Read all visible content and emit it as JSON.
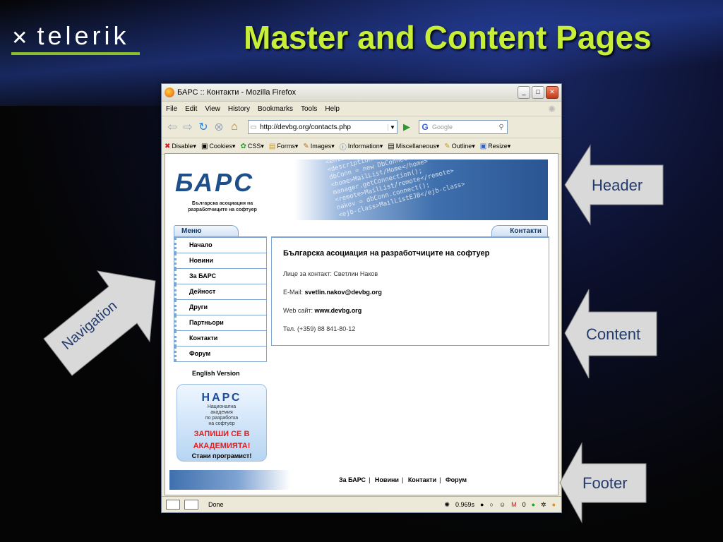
{
  "slide": {
    "logo_text": "telerik",
    "title": "Master and Content Pages"
  },
  "browser": {
    "window_title": "БАРС :: Контакти - Mozilla Firefox",
    "menu": [
      "File",
      "Edit",
      "View",
      "History",
      "Bookmarks",
      "Tools",
      "Help"
    ],
    "url": "http://devbg.org/contacts.php",
    "search_placeholder": "Google",
    "devbar": [
      "Disable▾",
      "Cookies▾",
      "CSS▾",
      "Forms▾",
      "Images▾",
      "Information▾",
      "Miscellaneous▾",
      "Outline▾",
      "Resize▾"
    ],
    "status_text": "Done",
    "status_time": "0.969s",
    "mail_count": "0"
  },
  "site": {
    "logo": "БАРС",
    "logo_sub": "Българска асоциация на разработчиците на софтуер",
    "menu_title": "Меню",
    "menu_items": [
      "Начало",
      "Новини",
      "За БАРС",
      "Дейност",
      "Други",
      "Партньори",
      "Контакти",
      "Форум"
    ],
    "english_link": "English Version",
    "ad": {
      "brand": "НАРС",
      "sub1": "Национална",
      "sub2": "академия",
      "sub3": "по разработка",
      "sub4": "на софтуер",
      "cta1": "ЗАПИШИ СЕ В",
      "cta2": "АКАДЕМИЯТА!",
      "cta3": "Стани програмист!"
    },
    "content_tab": "Контакти",
    "content": {
      "heading": "Българска асоциация на разработчиците на софтуер",
      "contact_label": "Лице за контакт: Светлин Наков",
      "email_label": "E-Mail:",
      "email_value": "svetlin.nakov@devbg.org",
      "web_label": "Web сайт:",
      "web_value": "www.devbg.org",
      "phone": "Тел. (+359) 88 841-80-12"
    },
    "footer_links": [
      "За БАРС",
      "Новини",
      "Контакти",
      "Форум"
    ]
  },
  "callouts": {
    "header": "Header",
    "navigation": "Navigation",
    "content": "Content",
    "footer": "Footer"
  },
  "colors": {
    "title": "#c7ef38",
    "callout_fill": "#d9d9d9",
    "callout_text": "#233c6e",
    "logo_underline": "#8cbf2c"
  }
}
